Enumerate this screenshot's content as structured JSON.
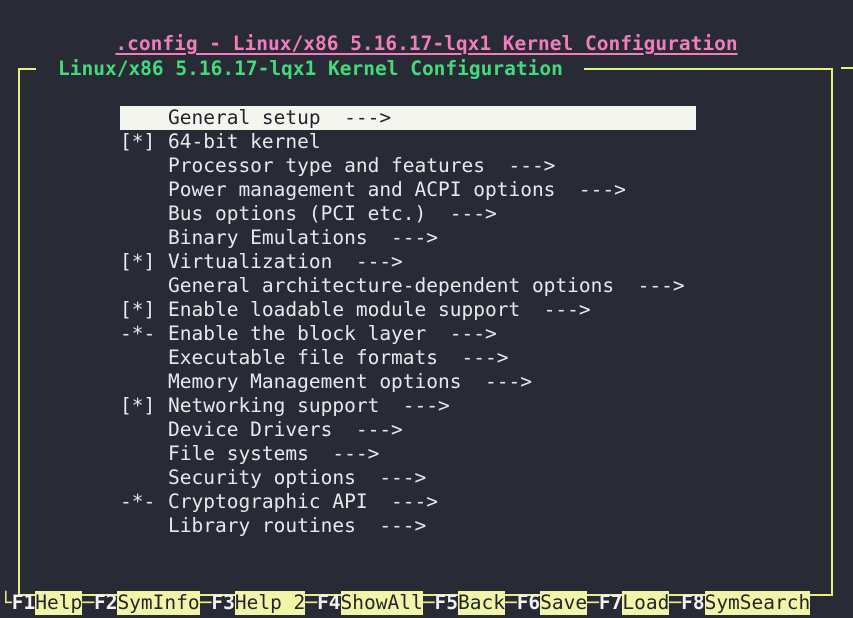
{
  "window": {
    "title": ".config - Linux/x86 5.16.17-lqx1 Kernel Configuration",
    "frame_legend": "Linux/x86 5.16.17-lqx1 Kernel Configuration"
  },
  "colors": {
    "background": "#282a36",
    "title_pink": "#ef7ebb",
    "frame_yellow": "#e9ef7e",
    "legend_green": "#45d97b",
    "text": "#e8e8ec",
    "selection_bg": "#f5f5ef",
    "selection_fg": "#22242e",
    "fkey_highlight_bg": "#f2f5a8"
  },
  "menu": {
    "selected_index": 0,
    "items": [
      {
        "mark": "",
        "label": "General setup  --->",
        "selected": true
      },
      {
        "mark": "[*]",
        "label": "64-bit kernel",
        "selected": false
      },
      {
        "mark": "",
        "label": "Processor type and features  --->",
        "selected": false
      },
      {
        "mark": "",
        "label": "Power management and ACPI options  --->",
        "selected": false
      },
      {
        "mark": "",
        "label": "Bus options (PCI etc.)  --->",
        "selected": false
      },
      {
        "mark": "",
        "label": "Binary Emulations  --->",
        "selected": false
      },
      {
        "mark": "[*]",
        "label": "Virtualization  --->",
        "selected": false
      },
      {
        "mark": "",
        "label": "General architecture-dependent options  --->",
        "selected": false
      },
      {
        "mark": "[*]",
        "label": "Enable loadable module support  --->",
        "selected": false
      },
      {
        "mark": "-*-",
        "label": "Enable the block layer  --->",
        "selected": false
      },
      {
        "mark": "",
        "label": "Executable file formats  --->",
        "selected": false
      },
      {
        "mark": "",
        "label": "Memory Management options  --->",
        "selected": false
      },
      {
        "mark": "[*]",
        "label": "Networking support  --->",
        "selected": false
      },
      {
        "mark": "",
        "label": "Device Drivers  --->",
        "selected": false
      },
      {
        "mark": "",
        "label": "File systems  --->",
        "selected": false
      },
      {
        "mark": "",
        "label": "Security options  --->",
        "selected": false
      },
      {
        "mark": "-*-",
        "label": "Cryptographic API  --->",
        "selected": false
      },
      {
        "mark": "",
        "label": "Library routines  --->",
        "selected": false
      }
    ]
  },
  "function_bar": {
    "leading": "└",
    "separator": "─",
    "keys": [
      {
        "key": "F1",
        "action": "Help"
      },
      {
        "key": "F2",
        "action": "SymInfo"
      },
      {
        "key": "F3",
        "action": "Help 2"
      },
      {
        "key": "F4",
        "action": "ShowAll"
      },
      {
        "key": "F5",
        "action": "Back"
      },
      {
        "key": "F6",
        "action": "Save"
      },
      {
        "key": "F7",
        "action": "Load"
      },
      {
        "key": "F8",
        "action": "SymSearch"
      }
    ]
  }
}
